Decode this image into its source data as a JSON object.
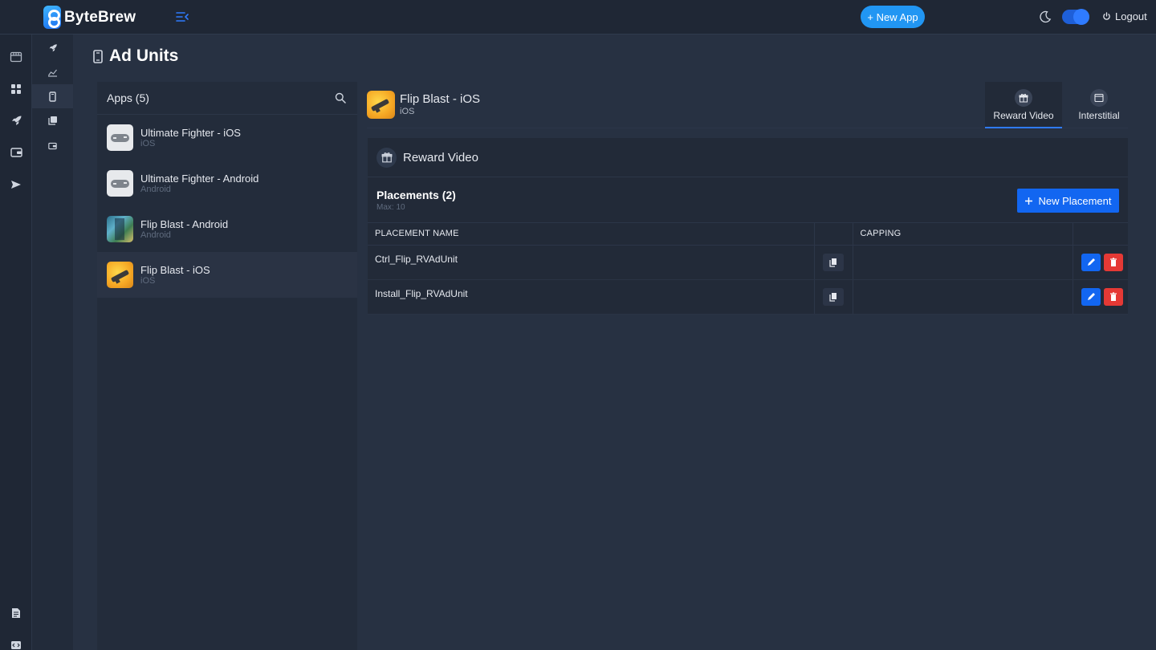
{
  "brand": {
    "name": "ByteBrew"
  },
  "header": {
    "new_app_label": "+ New App",
    "logout_label": "Logout"
  },
  "page": {
    "title": "Ad Units"
  },
  "apps": {
    "title": "Apps (5)",
    "items": [
      {
        "name": "Ultimate Fighter - iOS",
        "platform": "iOS",
        "icon": "gamepad-icon"
      },
      {
        "name": "Ultimate Fighter - Android",
        "platform": "Android",
        "icon": "gamepad-icon"
      },
      {
        "name": "Flip Blast - Android",
        "platform": "Android",
        "icon": "flip-blast-android-icon"
      },
      {
        "name": "Flip Blast - iOS",
        "platform": "iOS",
        "icon": "flip-blast-ios-icon"
      }
    ]
  },
  "detail": {
    "app_name": "Flip Blast - iOS",
    "platform": "iOS",
    "tabs": [
      {
        "label": "Reward Video"
      },
      {
        "label": "Interstitial"
      }
    ],
    "card_title": "Reward Video",
    "placements_title": "Placements (2)",
    "placements_max": "Max: 10",
    "new_placement_label": "New Placement",
    "columns": {
      "name": "PLACEMENT NAME",
      "capping": "CAPPING"
    },
    "rows": [
      {
        "name": "Ctrl_Flip_RVAdUnit",
        "capping": ""
      },
      {
        "name": "Install_Flip_RVAdUnit",
        "capping": ""
      }
    ]
  },
  "colors": {
    "accent": "#1266f1",
    "danger": "#e53935",
    "pill": "#2196f3",
    "background": "#273142"
  }
}
